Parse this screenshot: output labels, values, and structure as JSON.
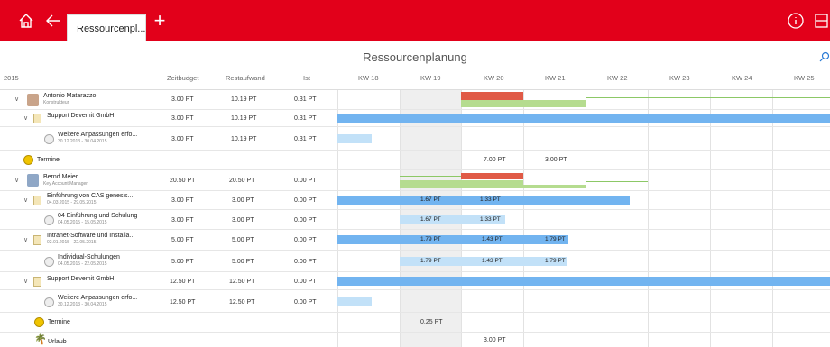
{
  "topbar": {
    "tab_label": "Ressourcenpl...",
    "plus": "+"
  },
  "page": {
    "title": "Ressourcenplanung"
  },
  "columns": {
    "year": "2015",
    "zeitbudget": "Zeitbudget",
    "restaufwand": "Restaufwand",
    "ist": "Ist",
    "weeks": [
      "KW 18",
      "KW 19",
      "KW 20",
      "KW 21",
      "KW 22",
      "KW 23",
      "KW 24",
      "KW 25"
    ]
  },
  "rows": [
    {
      "name": "Antonio Matarazzo",
      "sub": "Konstrukteur",
      "zb": "3.00 PT",
      "ra": "10.19 PT",
      "ist": "0.31 PT"
    },
    {
      "name": "Support Devemit GmbH",
      "sub": "",
      "zb": "3.00 PT",
      "ra": "10.19 PT",
      "ist": "0.31 PT"
    },
    {
      "name": "Weitere Anpassungen erfo...",
      "sub": "30.12.2013 - 30.04.2015",
      "zb": "3.00 PT",
      "ra": "10.19 PT",
      "ist": "0.31 PT"
    },
    {
      "name": "Termine",
      "sub": "",
      "zb": "",
      "ra": "",
      "ist": "",
      "w20": "7.00 PT",
      "w21": "3.00 PT"
    },
    {
      "name": "Bernd Meier",
      "sub": "Key Account Manager",
      "zb": "20.50 PT",
      "ra": "20.50 PT",
      "ist": "0.00 PT"
    },
    {
      "name": "Einführung von CAS genesis...",
      "sub": "04.03.2015 - 29.05.2015",
      "zb": "3.00 PT",
      "ra": "3.00 PT",
      "ist": "0.00 PT",
      "w19": "1.67 PT",
      "w20": "1.33 PT"
    },
    {
      "name": "04 Einführung und Schulung",
      "sub": "04.05.2015 - 15.05.2015",
      "zb": "3.00 PT",
      "ra": "3.00 PT",
      "ist": "0.00 PT",
      "w19": "1.67 PT",
      "w20": "1.33 PT"
    },
    {
      "name": "Intranet-Software und Installa...",
      "sub": "02.01.2015 - 22.05.2015",
      "zb": "5.00 PT",
      "ra": "5.00 PT",
      "ist": "0.00 PT",
      "w19": "1.79 PT",
      "w20": "1.43 PT",
      "w21": "1.79 PT"
    },
    {
      "name": "Individual-Schulungen",
      "sub": "04.05.2015 - 22.05.2015",
      "zb": "5.00 PT",
      "ra": "5.00 PT",
      "ist": "0.00 PT",
      "w19": "1.79 PT",
      "w20": "1.43 PT",
      "w21": "1.79 PT"
    },
    {
      "name": "Support Devemit GmbH",
      "sub": "",
      "zb": "12.50 PT",
      "ra": "12.50 PT",
      "ist": "0.00 PT"
    },
    {
      "name": "Weitere Anpassungen erfo...",
      "sub": "30.12.2013 - 30.04.2015",
      "zb": "12.50 PT",
      "ra": "12.50 PT",
      "ist": "0.00 PT"
    },
    {
      "name": "Termine",
      "sub": "",
      "zb": "",
      "ra": "",
      "ist": "",
      "w19": "0.25 PT"
    },
    {
      "name": "Urlaub",
      "sub": "",
      "zb": "",
      "ra": "",
      "ist": "",
      "w20": "3.00 PT"
    }
  ]
}
